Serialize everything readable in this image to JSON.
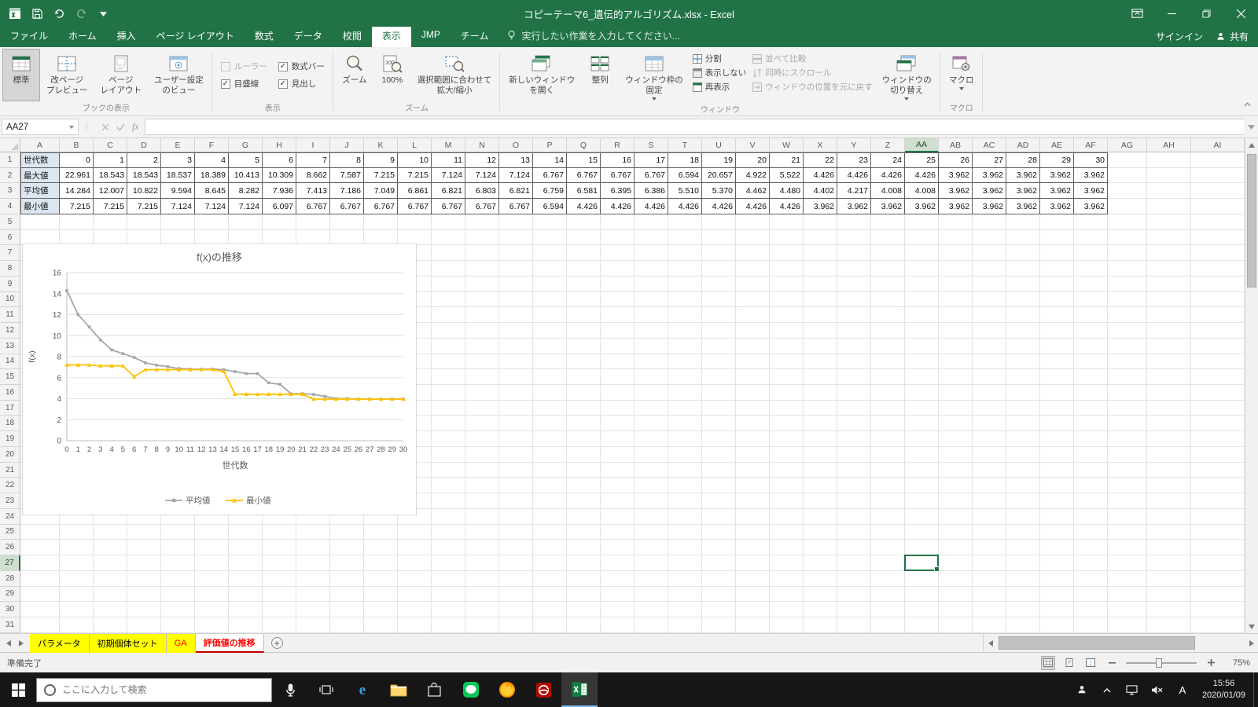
{
  "theme": {
    "accent": "#217346",
    "tab_yellow": "#ffff00",
    "tab_red_text": "#ff0000",
    "series_gray": "#a6a6a6",
    "series_yellow": "#ffc000"
  },
  "titlebar": {
    "title": "コピーテーマ6_遺伝的アルゴリズム.xlsx - Excel"
  },
  "tabs": {
    "items": [
      {
        "label": "ファイル",
        "active": false
      },
      {
        "label": "ホーム",
        "active": false
      },
      {
        "label": "挿入",
        "active": false
      },
      {
        "label": "ページ レイアウト",
        "active": false
      },
      {
        "label": "数式",
        "active": false
      },
      {
        "label": "データ",
        "active": false
      },
      {
        "label": "校閲",
        "active": false
      },
      {
        "label": "表示",
        "active": true
      },
      {
        "label": "JMP",
        "active": false
      },
      {
        "label": "チーム",
        "active": false
      }
    ],
    "tell_me": "実行したい作業を入力してください...",
    "sign_in": "サインイン",
    "share": "共有"
  },
  "ribbon": {
    "book_views": {
      "label": "ブックの表示",
      "normal": "標準",
      "page_break": "改ページ\nプレビュー",
      "page_layout": "ページ\nレイアウト",
      "custom": "ユーザー設定\nのビュー"
    },
    "show": {
      "label": "表示",
      "ruler": "ルーラー",
      "formula_bar": "数式バー",
      "gridlines": "目盛線",
      "headings": "見出し"
    },
    "zoom": {
      "label": "ズーム",
      "zoom": "ズーム",
      "hundred": "100%",
      "fit": "選択範囲に合わせて\n拡大/縮小"
    },
    "window": {
      "label": "ウィンドウ",
      "new_window": "新しいウィンドウ\nを開く",
      "arrange": "整列",
      "freeze": "ウィンドウ枠の\n固定",
      "split": "分割",
      "hide": "表示しない",
      "unhide": "再表示",
      "view_side": "並べて比較",
      "sync_scroll": "同時にスクロール",
      "reset_position": "ウィンドウの位置を元に戻す",
      "switch": "ウィンドウの\n切り替え"
    },
    "macros": {
      "label": "マクロ",
      "macros": "マクロ"
    }
  },
  "formula_bar": {
    "name_box": "AA27",
    "formula": ""
  },
  "grid": {
    "selected_cell": "AA27",
    "selected_column": "AA",
    "selected_row": 27,
    "columns": [
      "A",
      "B",
      "C",
      "D",
      "E",
      "F",
      "G",
      "H",
      "I",
      "J",
      "K",
      "L",
      "M",
      "N",
      "O",
      "P",
      "Q",
      "R",
      "S",
      "T",
      "U",
      "V",
      "W",
      "X",
      "Y",
      "Z",
      "AA",
      "AB",
      "AC",
      "AD",
      "AE",
      "AF",
      "AG",
      "AH",
      "AI"
    ],
    "row_count": 31,
    "table": {
      "row_labels": [
        "世代数",
        "最大値",
        "平均値",
        "最小値"
      ],
      "generations": [
        0,
        1,
        2,
        3,
        4,
        5,
        6,
        7,
        8,
        9,
        10,
        11,
        12,
        13,
        14,
        15,
        16,
        17,
        18,
        19,
        20,
        21,
        22,
        23,
        24,
        25,
        26,
        27,
        28,
        29,
        30
      ],
      "max": [
        22.961,
        18.543,
        18.543,
        18.537,
        18.389,
        10.413,
        10.309,
        8.662,
        7.587,
        7.215,
        7.215,
        7.124,
        7.124,
        7.124,
        6.767,
        6.767,
        6.767,
        6.767,
        6.594,
        20.657,
        4.922,
        5.522,
        4.426,
        4.426,
        4.426,
        4.426,
        3.962,
        3.962,
        3.962,
        3.962,
        3.962
      ],
      "avg": [
        14.284,
        12.007,
        10.822,
        9.594,
        8.645,
        8.282,
        7.936,
        7.413,
        7.186,
        7.049,
        6.861,
        6.821,
        6.803,
        6.821,
        6.759,
        6.581,
        6.395,
        6.386,
        5.51,
        5.37,
        4.462,
        4.48,
        4.402,
        4.217,
        4.008,
        4.008,
        3.962,
        3.962,
        3.962,
        3.962,
        3.962
      ],
      "min": [
        7.215,
        7.215,
        7.215,
        7.124,
        7.124,
        7.124,
        6.097,
        6.767,
        6.767,
        6.767,
        6.767,
        6.767,
        6.767,
        6.767,
        6.594,
        4.426,
        4.426,
        4.426,
        4.426,
        4.426,
        4.426,
        4.426,
        3.962,
        3.962,
        3.962,
        3.962,
        3.962,
        3.962,
        3.962,
        3.962,
        3.962
      ]
    }
  },
  "chart_data": {
    "type": "line",
    "title": "f(x)の推移",
    "xlabel": "世代数",
    "ylabel": "f(x)",
    "ylim": [
      0,
      16
    ],
    "grid": true,
    "legend_position": "bottom",
    "x": [
      0,
      1,
      2,
      3,
      4,
      5,
      6,
      7,
      8,
      9,
      10,
      11,
      12,
      13,
      14,
      15,
      16,
      17,
      18,
      19,
      20,
      21,
      22,
      23,
      24,
      25,
      26,
      27,
      28,
      29,
      30
    ],
    "series": [
      {
        "name": "平均値",
        "color": "#a6a6a6",
        "marker": "square",
        "values": [
          14.284,
          12.007,
          10.822,
          9.594,
          8.645,
          8.282,
          7.936,
          7.413,
          7.186,
          7.049,
          6.861,
          6.821,
          6.803,
          6.821,
          6.759,
          6.581,
          6.395,
          6.386,
          5.51,
          5.37,
          4.462,
          4.48,
          4.402,
          4.217,
          4.008,
          4.008,
          3.962,
          3.962,
          3.962,
          3.962,
          3.962
        ]
      },
      {
        "name": "最小値",
        "color": "#ffc000",
        "marker": "triangle",
        "values": [
          7.215,
          7.215,
          7.215,
          7.124,
          7.124,
          7.124,
          6.097,
          6.767,
          6.767,
          6.767,
          6.767,
          6.767,
          6.767,
          6.767,
          6.594,
          4.426,
          4.426,
          4.426,
          4.426,
          4.426,
          4.426,
          4.426,
          3.962,
          3.962,
          3.962,
          3.962,
          3.962,
          3.962,
          3.962,
          3.962,
          3.962
        ]
      }
    ]
  },
  "sheet_tabs": {
    "items": [
      {
        "label": "パラメータ",
        "fill": "#ffff00",
        "text": "#000000",
        "active": false
      },
      {
        "label": "初期個体セット",
        "fill": "#ffff00",
        "text": "#000000",
        "active": false
      },
      {
        "label": "GA",
        "fill": "#ffff00",
        "text": "#ff0000",
        "active": false
      },
      {
        "label": "評価値の推移",
        "fill": "#ffffff",
        "text": "#ff0000",
        "active": true
      }
    ]
  },
  "status_bar": {
    "mode": "準備完了",
    "zoom": "75%"
  },
  "taskbar": {
    "search_placeholder": "ここに入力して検索",
    "ime": "A",
    "time": "15:56",
    "date": "2020/01/09"
  }
}
